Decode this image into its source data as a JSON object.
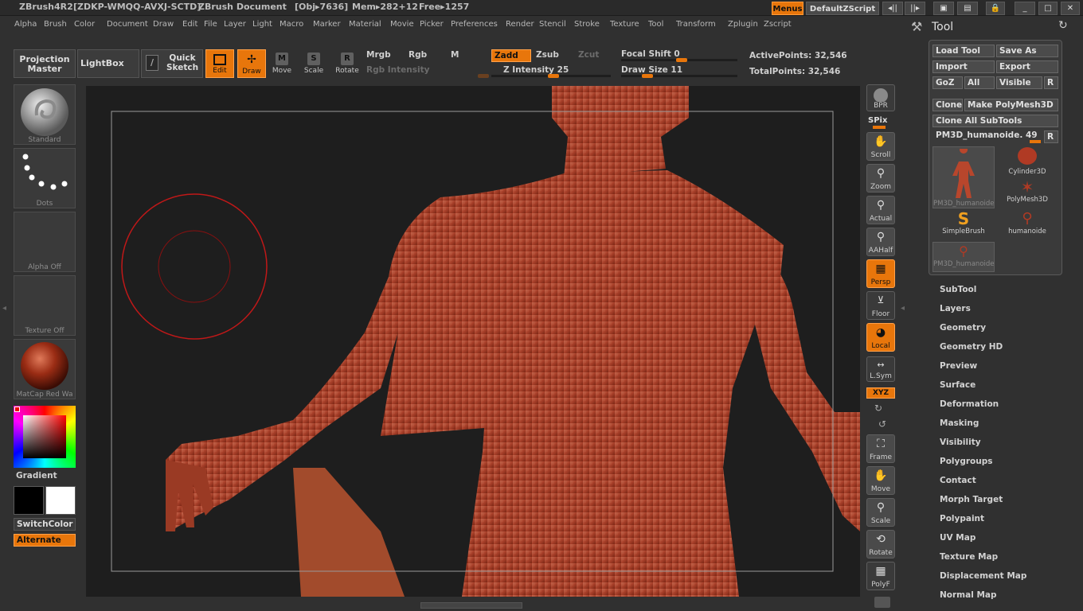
{
  "titlebar": {
    "app": "ZBrush4R2",
    "serial": "[ZDKP-WMQQ-AVXJ-SCTD]",
    "document": "ZBrush Document",
    "obj": "[Obj▸7636]",
    "mem": "Mem▸282+12",
    "free": "Free▸1257",
    "menus_label": "Menus",
    "script_label": "DefaultZScript"
  },
  "menubar": [
    "Alpha",
    "Brush",
    "Color",
    "Document",
    "Draw",
    "Edit",
    "File",
    "Layer",
    "Light",
    "Macro",
    "Marker",
    "Material",
    "Movie",
    "Picker",
    "Preferences",
    "Render",
    "Stencil",
    "Stroke",
    "Texture",
    "Tool",
    "Transform",
    "Zplugin",
    "Zscript"
  ],
  "toolbar": {
    "projection_master": "Projection Master",
    "lightbox": "LightBox",
    "quick_sketch": "Quick Sketch",
    "edit": "Edit",
    "draw": "Draw",
    "move": "Move",
    "scale": "Scale",
    "rotate": "Rotate",
    "mrgb": "Mrgb",
    "rgb": "Rgb",
    "m": "M",
    "rgb_intensity": "Rgb Intensity",
    "zadd": "Zadd",
    "zsub": "Zsub",
    "zcut": "Zcut",
    "z_intensity": "Z Intensity 25",
    "focal_shift": "Focal Shift 0",
    "draw_size": "Draw Size 11",
    "active_points": "ActivePoints: 32,546",
    "total_points": "TotalPoints: 32,546"
  },
  "left_shelf": {
    "brush": "Standard",
    "stroke": "Dots",
    "alpha": "Alpha Off",
    "texture": "Texture Off",
    "material": "MatCap Red Wa",
    "gradient": "Gradient",
    "switch_color": "SwitchColor",
    "alternate": "Alternate"
  },
  "right_shelf": {
    "bpr": "BPR",
    "spix": "SPix",
    "scroll": "Scroll",
    "zoom": "Zoom",
    "actual": "Actual",
    "aahalf": "AAHalf",
    "persp": "Persp",
    "floor": "Floor",
    "local": "Local",
    "lsym": "L.Sym",
    "xyz": "XYZ",
    "frame": "Frame",
    "move": "Move",
    "scale": "Scale",
    "rotate": "Rotate",
    "polyf": "PolyF"
  },
  "tool_panel": {
    "title": "Tool",
    "load_tool": "Load Tool",
    "save_as": "Save As",
    "import": "Import",
    "export": "Export",
    "goz": "GoZ",
    "all": "All",
    "visible": "Visible",
    "r": "R",
    "clone": "Clone",
    "make_polymesh": "Make PolyMesh3D",
    "clone_all": "Clone All SubTools",
    "current_tool": "PM3D_humanoide. 49",
    "thumbs": [
      "PM3D_humanoide",
      "Cylinder3D",
      "PolyMesh3D",
      "SimpleBrush",
      "humanoide",
      "PM3D_humanoide"
    ]
  },
  "subpalettes": [
    "SubTool",
    "Layers",
    "Geometry",
    "Geometry HD",
    "Preview",
    "Surface",
    "Deformation",
    "Masking",
    "Visibility",
    "Polygroups",
    "Contact",
    "Morph Target",
    "Polypaint",
    "UV Map",
    "Texture Map",
    "Displacement Map",
    "Normal Map"
  ],
  "colors": {
    "accent": "#e8760b",
    "canvas": "#1e1e1e",
    "panel": "#303030",
    "brush_ring": "#c01818"
  }
}
